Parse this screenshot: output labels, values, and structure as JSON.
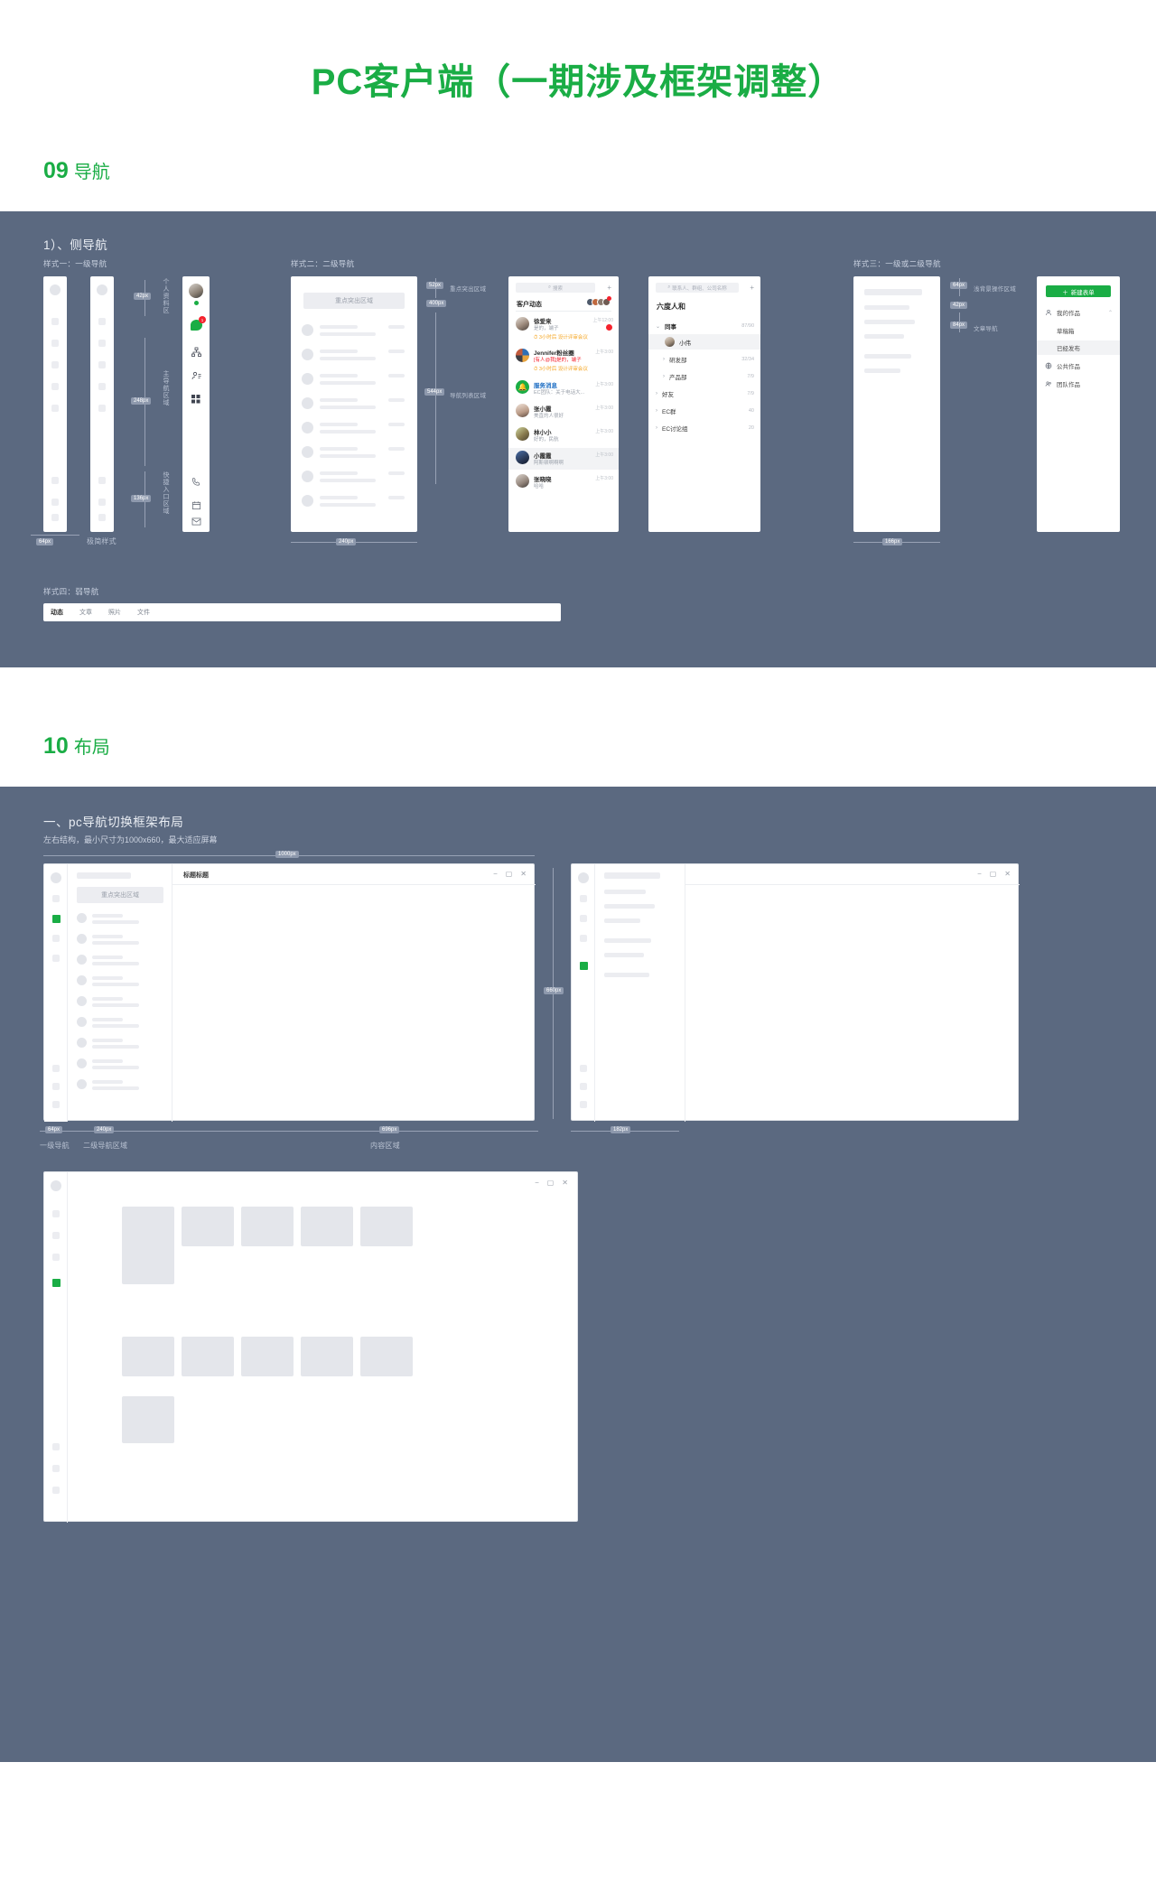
{
  "doc": {
    "title": "PC客户端（一期涉及框架调整）",
    "accent": "#1AAD45",
    "panel_bg": "#5B6980"
  },
  "sections": [
    {
      "num": "09",
      "name": "导航"
    },
    {
      "num": "10",
      "name": "布局"
    }
  ],
  "nav_section": {
    "subtitle": "1）、侧导航",
    "style_one": {
      "label": "样式一：一级导航",
      "bottom_meas": "64px",
      "bottom_label": "极简样式",
      "measures": [
        {
          "value": "42px",
          "region": "个人资料区"
        },
        {
          "value": "248px",
          "region": "主导航区域"
        },
        {
          "value": "136px",
          "region": "快捷入口区域"
        }
      ]
    },
    "style_two": {
      "label": "样式二：二级导航",
      "highlight_block": "重点突出区域",
      "measures": [
        {
          "value": "52px",
          "region": "重点突出区域"
        },
        {
          "value": "400px",
          "region": ""
        },
        {
          "value": "544px",
          "region": "导航列表区域"
        }
      ],
      "bottom_meas": "240px",
      "chat_panel": {
        "search_placeholder": "搜索",
        "add_icon": "plus-icon",
        "header_title": "客户动态",
        "items": [
          {
            "name": "徐爱来",
            "sub": "是的，端子",
            "time": "上午12:00",
            "meeting": "3小时后 设计评审会议",
            "badge": "",
            "selected": false
          },
          {
            "name": "Jennifer粉丝圈",
            "sub": "[有人@我]是的，端子",
            "time": "上午3:00",
            "meeting": "3小时后 设计评审会议",
            "badge": "",
            "selected": false
          },
          {
            "name": "服务消息",
            "sub": "EC团队：关于电话大...",
            "time": "上午3:00",
            "meeting": "",
            "badge": "",
            "selected": false
          },
          {
            "name": "张小霞",
            "sub": "美直的人很好",
            "time": "上午3:00",
            "meeting": "",
            "badge": "",
            "selected": false
          },
          {
            "name": "林小小",
            "sub": "好的，民航",
            "time": "上午3:00",
            "meeting": "",
            "badge": "",
            "selected": false
          },
          {
            "name": "小霞霞",
            "sub": "阿斯顿啊啊啊",
            "time": "上午3:00",
            "meeting": "",
            "badge": "",
            "selected": true
          },
          {
            "name": "张晓晓",
            "sub": "哈哈",
            "time": "上午3:00",
            "meeting": "",
            "badge": "",
            "selected": false
          }
        ]
      },
      "contacts_panel": {
        "search_placeholder": "联系人、群组、公司名称",
        "add_icon": "plus-icon",
        "org_title": "六度人和",
        "groups": [
          {
            "label": "同事",
            "count": "87/90",
            "expanded": true,
            "selected": false,
            "indent": 0,
            "avatar": false
          },
          {
            "label": "小伟",
            "count": "",
            "expanded": false,
            "selected": true,
            "indent": 1,
            "avatar": true
          },
          {
            "label": "研发部",
            "count": "32/34",
            "expanded": false,
            "selected": false,
            "indent": 1,
            "avatar": false
          },
          {
            "label": "产品部",
            "count": "7/9",
            "expanded": false,
            "selected": false,
            "indent": 1,
            "avatar": false
          },
          {
            "label": "好友",
            "count": "7/9",
            "expanded": false,
            "selected": false,
            "indent": 0,
            "avatar": false
          },
          {
            "label": "EC群",
            "count": "40",
            "expanded": false,
            "selected": false,
            "indent": 0,
            "avatar": false
          },
          {
            "label": "EC讨论组",
            "count": "20",
            "expanded": false,
            "selected": false,
            "indent": 0,
            "avatar": false
          }
        ]
      }
    },
    "style_three": {
      "label": "样式三：一级或二级导航",
      "measures": [
        {
          "value": "64px",
          "region": "浅背景操作区域"
        },
        {
          "value": "42px",
          "region": ""
        },
        {
          "value": "84px",
          "region": "文章导航"
        }
      ],
      "bottom_meas": "166px",
      "menu_panel": {
        "create_button": "新建表单",
        "create_icon": "plus-icon",
        "items": [
          {
            "label": "我的作品",
            "icon": "user-icon",
            "chevron": "chevron-up-icon",
            "selected": false,
            "indent": false
          },
          {
            "label": "草稿箱",
            "icon": "",
            "chevron": "",
            "selected": false,
            "indent": true
          },
          {
            "label": "已经发布",
            "icon": "",
            "chevron": "",
            "selected": true,
            "indent": true
          },
          {
            "label": "公共作品",
            "icon": "globe-icon",
            "chevron": "",
            "selected": false,
            "indent": false
          },
          {
            "label": "团队作品",
            "icon": "team-icon",
            "chevron": "",
            "selected": false,
            "indent": false
          }
        ]
      }
    },
    "style_four": {
      "label": "样式四：弱导航",
      "tabs": [
        {
          "label": "动态",
          "active": true
        },
        {
          "label": "文章",
          "active": false
        },
        {
          "label": "照片",
          "active": false
        },
        {
          "label": "文件",
          "active": false
        }
      ]
    }
  },
  "layout_section": {
    "subtitle": "一、pc导航切换框架布局",
    "desc": "左右结构，最小尺寸为1000x660，最大适应屏幕",
    "top_meas": "1000px",
    "side_meas": "660px",
    "window_title": "标题标题",
    "window_highlight": "重点突出区域",
    "bottom_measures": [
      {
        "value": "64px",
        "label": "一级导航"
      },
      {
        "value": "240px",
        "label": "二级导航区域"
      },
      {
        "value": "696px",
        "label": "内容区域"
      }
    ],
    "second_window_meas": "182px",
    "win_controls": {
      "minimize": "−",
      "maximize": "▢",
      "close": "✕"
    }
  }
}
